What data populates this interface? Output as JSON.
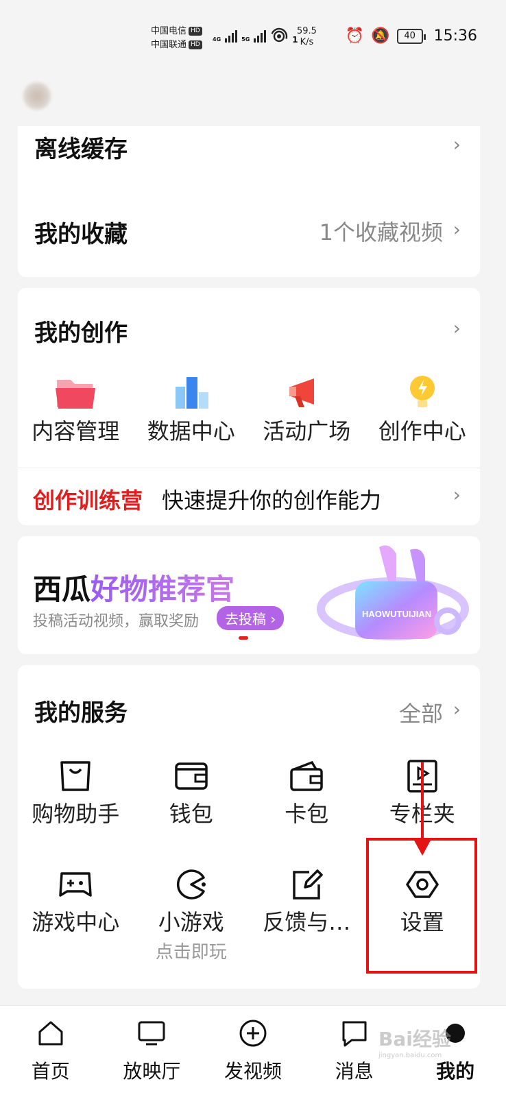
{
  "status": {
    "carrier1": "中国电信",
    "carrier2": "中国联通",
    "hd": "HD",
    "net1": "4G",
    "net2": "5G",
    "speed_value": "59.5",
    "speed_unit": "K/s",
    "wifi_count": "1",
    "battery": "40",
    "time": "15:36"
  },
  "offline": {
    "label": "离线缓存"
  },
  "favorites": {
    "label": "我的收藏",
    "extra": "1个收藏视频"
  },
  "creation": {
    "title": "我的创作",
    "items": [
      {
        "label": "内容管理",
        "icon": "folder-icon"
      },
      {
        "label": "数据中心",
        "icon": "chart-icon"
      },
      {
        "label": "活动广场",
        "icon": "megaphone-icon"
      },
      {
        "label": "创作中心",
        "icon": "bulb-icon"
      }
    ],
    "training_red": "创作训练营",
    "training_text": "快速提升你的创作能力"
  },
  "banner": {
    "title_black": "西瓜",
    "title_purple": "好物推荐官",
    "subtitle": "投稿活动视频，赢取奖励",
    "button": "去投稿",
    "image_text": "HAOWUTUIJIAN"
  },
  "services": {
    "title": "我的服务",
    "all": "全部",
    "row1": [
      {
        "label": "购物助手",
        "icon": "shopping-bag-icon"
      },
      {
        "label": "钱包",
        "icon": "wallet-icon"
      },
      {
        "label": "卡包",
        "icon": "card-wallet-icon"
      },
      {
        "label": "专栏夹",
        "icon": "column-icon"
      }
    ],
    "row2": [
      {
        "label": "游戏中心",
        "icon": "gamepad-icon"
      },
      {
        "label": "小游戏",
        "sub": "点击即玩",
        "icon": "pacman-icon"
      },
      {
        "label": "反馈与…",
        "icon": "edit-icon"
      },
      {
        "label": "设置",
        "icon": "settings-hex-icon"
      }
    ]
  },
  "nav": [
    {
      "label": "首页",
      "icon": "home-icon"
    },
    {
      "label": "放映厅",
      "icon": "tv-icon"
    },
    {
      "label": "发视频",
      "icon": "plus-circle-icon"
    },
    {
      "label": "消息",
      "icon": "message-icon"
    },
    {
      "label": "我的",
      "icon": "profile-dot-icon",
      "active": true
    }
  ],
  "watermark": {
    "main": "Bai经验",
    "sub": "jingyan.baidu.com"
  }
}
